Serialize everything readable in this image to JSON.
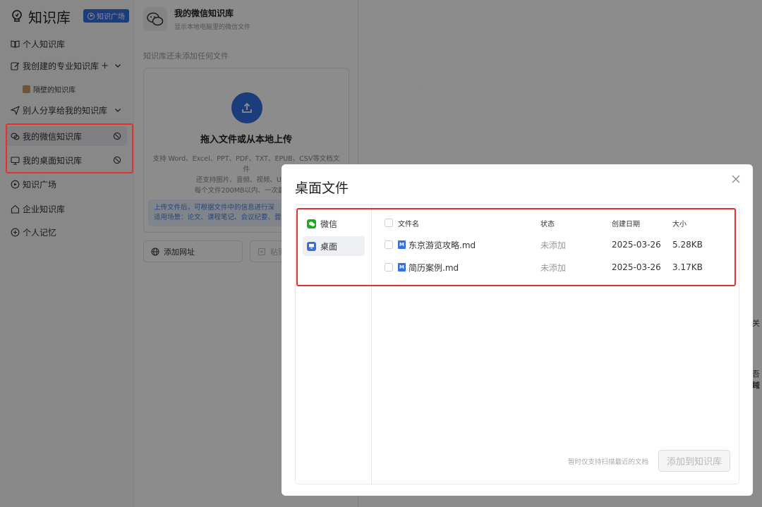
{
  "sidebar": {
    "brand_title": "知识库",
    "plaza_button": "知识广场",
    "items": {
      "personal": "个人知识库",
      "created": "我创建的专业知识库",
      "created_sub": "隔壁的知识库",
      "shared": "别人分享给我的知识库",
      "wechat": "我的微信知识库",
      "desktop": "我的桌面知识库",
      "plaza": "知识广场",
      "enterprise": "企业知识库",
      "memory": "个人记忆"
    },
    "add_symbol": "+"
  },
  "middle": {
    "title": "我的微信知识库",
    "subtitle": "显示本地电脑里的微信文件",
    "empty_note": "知识库还未添加任何文件",
    "upload_title": "拖入文件或从本地上传",
    "upload_desc_1": "支持 Word、Excel、PPT、PDF、TXT、EPUB、CSV等文档文件",
    "upload_desc_2": "还支持图片、音频、视频、URL等",
    "upload_desc_3": "每个文件200MB以内、一次最多上",
    "tip_1": "上传文件后，可根据文件中的信息进行深",
    "tip_2": "适用场景：论文、课程笔记、会议纪要、营",
    "add_url": "添加网址",
    "paste": "粘贴"
  },
  "edge": {
    "t1": "关",
    "t2": "吾跨",
    "t3": "域"
  },
  "modal": {
    "title": "桌面文件",
    "sources": [
      "微信",
      "桌面"
    ],
    "columns": {
      "name": "文件名",
      "status": "状态",
      "date": "创建日期",
      "size": "大小"
    },
    "files": [
      {
        "name": "东京游览攻略.md",
        "status": "未添加",
        "date": "2025-03-26",
        "size": "5.28KB"
      },
      {
        "name": "简历案例.md",
        "status": "未添加",
        "date": "2025-03-26",
        "size": "3.17KB"
      }
    ],
    "md_badge": "M",
    "footer_note": "暂时仅支持扫描最近的文档",
    "add_button": "添加到知识库"
  },
  "colors": {
    "accent": "#3470e0",
    "highlight": "#e5312b",
    "wechat_green": "#1aad19"
  }
}
